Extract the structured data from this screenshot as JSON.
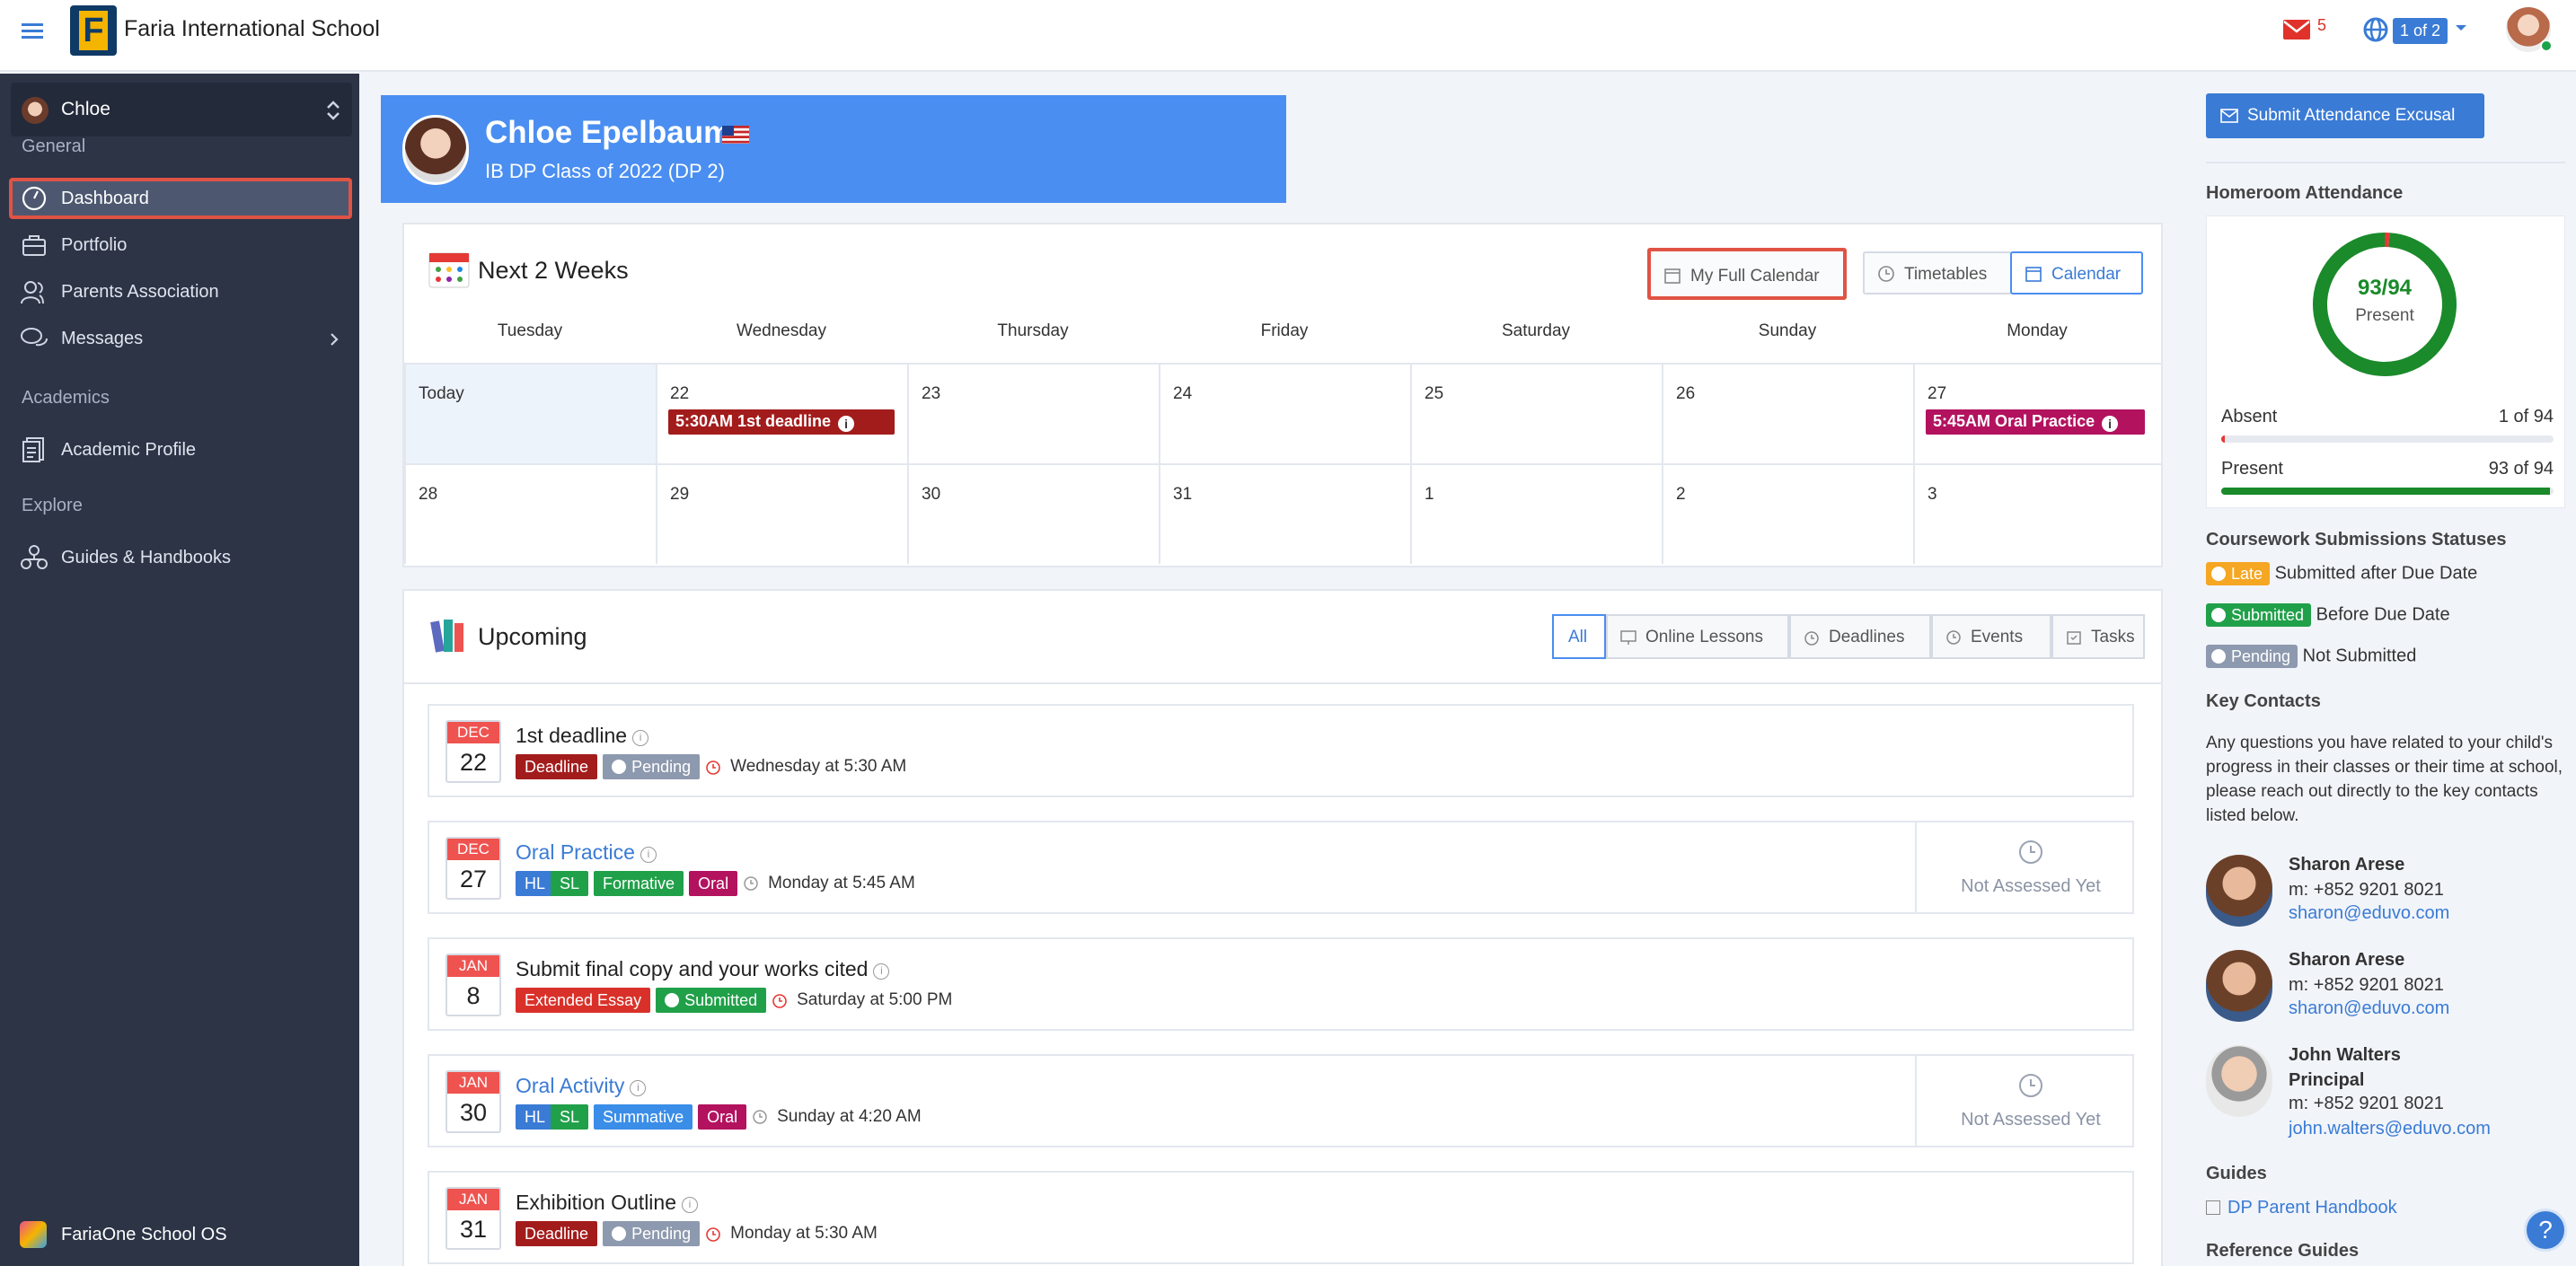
{
  "header": {
    "school_name": "Faria International School",
    "logo_letter": "F",
    "mail_count": "5",
    "pager": "1 of 2"
  },
  "sidebar": {
    "student_name": "Chloe",
    "sections": {
      "general": "General",
      "academics": "Academics",
      "explore": "Explore"
    },
    "items": [
      {
        "label": "Dashboard",
        "icon": "dashboard-gauge-icon",
        "active": true
      },
      {
        "label": "Portfolio",
        "icon": "briefcase-icon"
      },
      {
        "label": "Parents Association",
        "icon": "people-icon"
      },
      {
        "label": "Messages",
        "icon": "chat-bubbles-icon"
      },
      {
        "label": "Academic Profile",
        "icon": "document-icon"
      },
      {
        "label": "Guides & Handbooks",
        "icon": "network-icon"
      }
    ],
    "footer": "FariaOne School OS"
  },
  "banner": {
    "name": "Chloe Epelbaum",
    "class": "IB DP Class of 2022 (DP 2)"
  },
  "calendar": {
    "title": "Next 2 Weeks",
    "buttons": {
      "full": "My Full Calendar",
      "timetables": "Timetables",
      "calendar": "Calendar"
    },
    "weekdays": [
      "Tuesday",
      "Wednesday",
      "Thursday",
      "Friday",
      "Saturday",
      "Sunday",
      "Monday"
    ],
    "week1": [
      "Today",
      "22",
      "23",
      "24",
      "25",
      "26",
      "27"
    ],
    "week2": [
      "28",
      "29",
      "30",
      "31",
      "1",
      "2",
      "3"
    ],
    "events": {
      "wed": "5:30AM 1st deadline",
      "mon": "5:45AM Oral Practice"
    },
    "colors": {
      "deadline": "#a31c1c",
      "oral": "#b3125f"
    }
  },
  "upcoming": {
    "title": "Upcoming",
    "filters": [
      "All",
      "Online Lessons",
      "Deadlines",
      "Events",
      "Tasks"
    ],
    "not_assessed": "Not Assessed Yet",
    "items": [
      {
        "month": "DEC",
        "day": "22",
        "title": "1st deadline",
        "tags": [
          "Deadline",
          "Pending"
        ],
        "when": "Wednesday at 5:30 AM"
      },
      {
        "month": "DEC",
        "day": "27",
        "title": "Oral Practice",
        "tags": [
          "HL",
          "SL",
          "Formative",
          "Oral"
        ],
        "when": "Monday at 5:45 AM"
      },
      {
        "month": "JAN",
        "day": "8",
        "title": "Submit final copy and your works cited",
        "tags": [
          "Extended Essay",
          "Submitted"
        ],
        "when": "Saturday at 5:00 PM"
      },
      {
        "month": "JAN",
        "day": "30",
        "title": "Oral Activity",
        "tags": [
          "HL",
          "SL",
          "Summative",
          "Oral"
        ],
        "when": "Sunday at 4:20 AM"
      },
      {
        "month": "JAN",
        "day": "31",
        "title": "Exhibition Outline",
        "tags": [
          "Deadline",
          "Pending"
        ],
        "when": "Monday at 5:30 AM"
      }
    ]
  },
  "right": {
    "submit_button": "Submit Attendance Excusal",
    "homeroom_heading": "Homeroom Attendance",
    "attendance": {
      "value": "93/94",
      "label": "Present",
      "present_fraction": 0.989,
      "absent_label": "Absent",
      "absent_value": "1 of 94",
      "absent_fraction": 0.011,
      "present_label": "Present",
      "present_value": "93 of 94"
    },
    "statuses_heading": "Coursework Submissions Statuses",
    "statuses": [
      {
        "pill": "Late",
        "text": "Submitted after Due Date",
        "color": "#f5a623"
      },
      {
        "pill": "Submitted",
        "text": "Before Due Date",
        "color": "#21a04a"
      },
      {
        "pill": "Pending",
        "text": "Not Submitted",
        "color": "#8d99ae"
      }
    ],
    "key_contacts_heading": "Key Contacts",
    "key_contacts_text": "Any questions you have related to your child's progress in their classes or their time at school, please reach out directly to the key contacts listed below.",
    "contacts": [
      {
        "name": "Sharon Arese",
        "role": "",
        "phone": "m: +852 9201 8021",
        "email": "sharon@eduvo.com"
      },
      {
        "name": "Sharon Arese",
        "role": "",
        "phone": "m: +852 9201 8021",
        "email": "sharon@eduvo.com"
      },
      {
        "name": "John Walters",
        "role": "Principal",
        "phone": "m: +852 9201 8021",
        "email": "john.walters@eduvo.com"
      }
    ],
    "guides_heading": "Guides",
    "guide_link": "DP Parent Handbook",
    "reference_heading": "Reference Guides"
  },
  "help_label": "?"
}
